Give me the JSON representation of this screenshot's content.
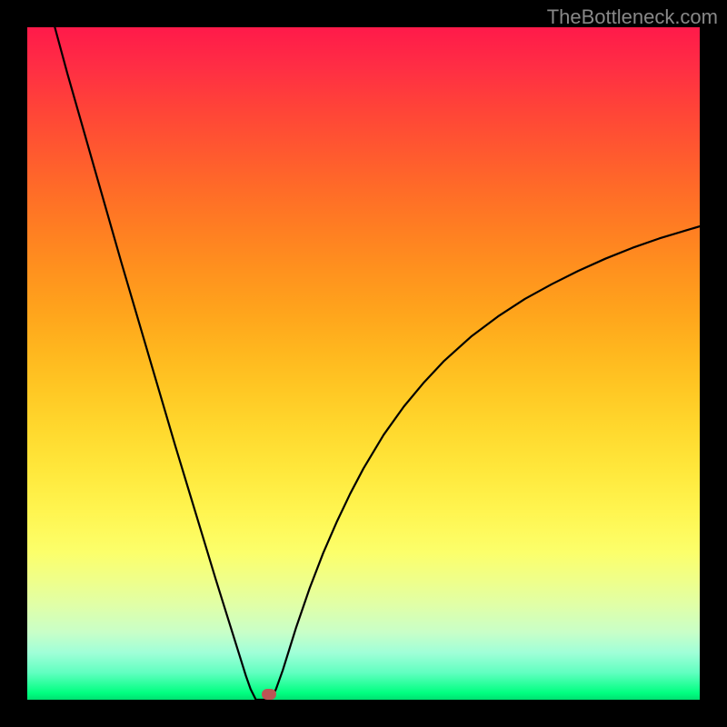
{
  "watermark": "TheBottleneck.com",
  "chart_data": {
    "type": "line",
    "title": "",
    "xlabel": "",
    "ylabel": "",
    "xlim": [
      0,
      100
    ],
    "ylim": [
      0,
      100
    ],
    "background_gradient": {
      "top": "#ff1a4a",
      "bottom": "#00e070"
    },
    "curve": {
      "stroke": "#000000",
      "stroke_width": 2.2,
      "points": [
        {
          "x": 4.1,
          "y": 100.0
        },
        {
          "x": 6.0,
          "y": 93.0
        },
        {
          "x": 8.0,
          "y": 86.0
        },
        {
          "x": 10.0,
          "y": 79.0
        },
        {
          "x": 12.0,
          "y": 72.0
        },
        {
          "x": 14.0,
          "y": 65.0
        },
        {
          "x": 16.0,
          "y": 58.2
        },
        {
          "x": 18.0,
          "y": 51.4
        },
        {
          "x": 20.0,
          "y": 44.6
        },
        {
          "x": 22.0,
          "y": 37.8
        },
        {
          "x": 24.0,
          "y": 31.2
        },
        {
          "x": 26.0,
          "y": 24.6
        },
        {
          "x": 28.0,
          "y": 18.0
        },
        {
          "x": 30.0,
          "y": 11.6
        },
        {
          "x": 31.5,
          "y": 6.8
        },
        {
          "x": 32.5,
          "y": 3.6
        },
        {
          "x": 33.2,
          "y": 1.6
        },
        {
          "x": 33.8,
          "y": 0.4
        },
        {
          "x": 34.0,
          "y": 0.0
        },
        {
          "x": 35.0,
          "y": 0.0
        },
        {
          "x": 36.0,
          "y": 0.0
        },
        {
          "x": 36.4,
          "y": 0.4
        },
        {
          "x": 37.0,
          "y": 1.6
        },
        {
          "x": 38.0,
          "y": 4.4
        },
        {
          "x": 39.0,
          "y": 7.6
        },
        {
          "x": 40.0,
          "y": 10.8
        },
        {
          "x": 42.0,
          "y": 16.6
        },
        {
          "x": 44.0,
          "y": 21.8
        },
        {
          "x": 46.0,
          "y": 26.4
        },
        {
          "x": 48.0,
          "y": 30.6
        },
        {
          "x": 50.0,
          "y": 34.4
        },
        {
          "x": 53.0,
          "y": 39.4
        },
        {
          "x": 56.0,
          "y": 43.6
        },
        {
          "x": 59.0,
          "y": 47.2
        },
        {
          "x": 62.0,
          "y": 50.4
        },
        {
          "x": 66.0,
          "y": 54.0
        },
        {
          "x": 70.0,
          "y": 57.0
        },
        {
          "x": 74.0,
          "y": 59.6
        },
        {
          "x": 78.0,
          "y": 61.8
        },
        {
          "x": 82.0,
          "y": 63.8
        },
        {
          "x": 86.0,
          "y": 65.6
        },
        {
          "x": 90.0,
          "y": 67.2
        },
        {
          "x": 94.0,
          "y": 68.6
        },
        {
          "x": 98.0,
          "y": 69.8
        },
        {
          "x": 100.0,
          "y": 70.4
        }
      ]
    },
    "marker": {
      "x": 36.0,
      "y": 0.8,
      "color": "#bb5555"
    }
  }
}
